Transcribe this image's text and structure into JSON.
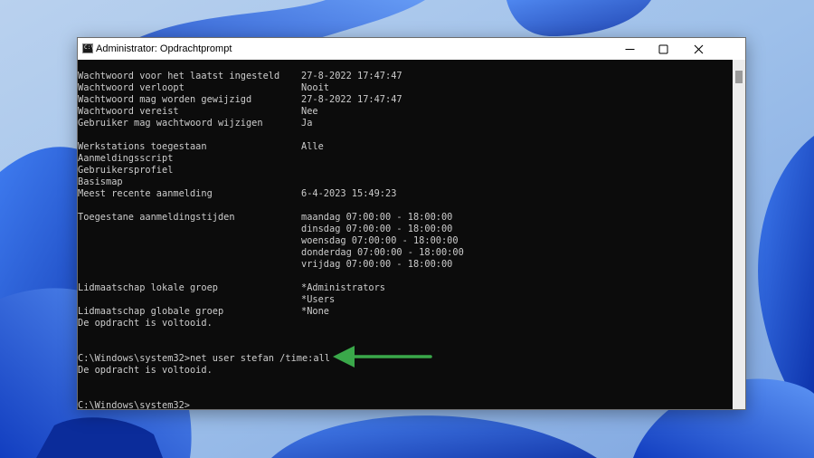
{
  "window": {
    "title": "Administrator: Opdrachtprompt",
    "icon": "cmd-icon",
    "icon_glyph": "C:\\",
    "controls": [
      "minimize-icon",
      "maximize-icon",
      "close-icon"
    ]
  },
  "console": {
    "lines": [
      {
        "label": "Wachtwoord voor het laatst ingesteld",
        "value": "27-8-2022 17:47:47"
      },
      {
        "label": "Wachtwoord verloopt",
        "value": "Nooit"
      },
      {
        "label": "Wachtwoord mag worden gewijzigd",
        "value": "27-8-2022 17:47:47"
      },
      {
        "label": "Wachtwoord vereist",
        "value": "Nee"
      },
      {
        "label": "Gebruiker mag wachtwoord wijzigen",
        "value": "Ja"
      },
      {
        "label": "",
        "value": ""
      },
      {
        "label": "Werkstations toegestaan",
        "value": "Alle"
      },
      {
        "label": "Aanmeldingsscript",
        "value": ""
      },
      {
        "label": "Gebruikersprofiel",
        "value": ""
      },
      {
        "label": "Basismap",
        "value": ""
      },
      {
        "label": "Meest recente aanmelding",
        "value": "6-4-2023 15:49:23"
      },
      {
        "label": "",
        "value": ""
      },
      {
        "label": "Toegestane aanmeldingstijden",
        "value": "maandag 07:00:00 - 18:00:00"
      },
      {
        "label": "",
        "value": "dinsdag 07:00:00 - 18:00:00"
      },
      {
        "label": "",
        "value": "woensdag 07:00:00 - 18:00:00"
      },
      {
        "label": "",
        "value": "donderdag 07:00:00 - 18:00:00"
      },
      {
        "label": "",
        "value": "vrijdag 07:00:00 - 18:00:00"
      },
      {
        "label": "",
        "value": ""
      },
      {
        "label": "Lidmaatschap lokale groep",
        "value": "*Administrators"
      },
      {
        "label": "",
        "value": "*Users"
      },
      {
        "label": "Lidmaatschap globale groep",
        "value": "*None"
      },
      {
        "label": "De opdracht is voltooid.",
        "value": ""
      },
      {
        "label": "",
        "value": ""
      },
      {
        "label": "",
        "value": ""
      },
      {
        "label": "C:\\Windows\\system32>net user stefan /time:all",
        "value": ""
      },
      {
        "label": "De opdracht is voltooid.",
        "value": ""
      },
      {
        "label": "",
        "value": ""
      },
      {
        "label": "",
        "value": ""
      },
      {
        "label": "C:\\Windows\\system32>",
        "value": ""
      }
    ]
  },
  "annotation": {
    "arrow_color": "#3aa84a",
    "icon": "arrow-left-icon"
  },
  "colors": {
    "console_bg": "#0c0c0c",
    "console_text": "#cccccc",
    "wallpaper_blue": "#1f4fd1"
  }
}
